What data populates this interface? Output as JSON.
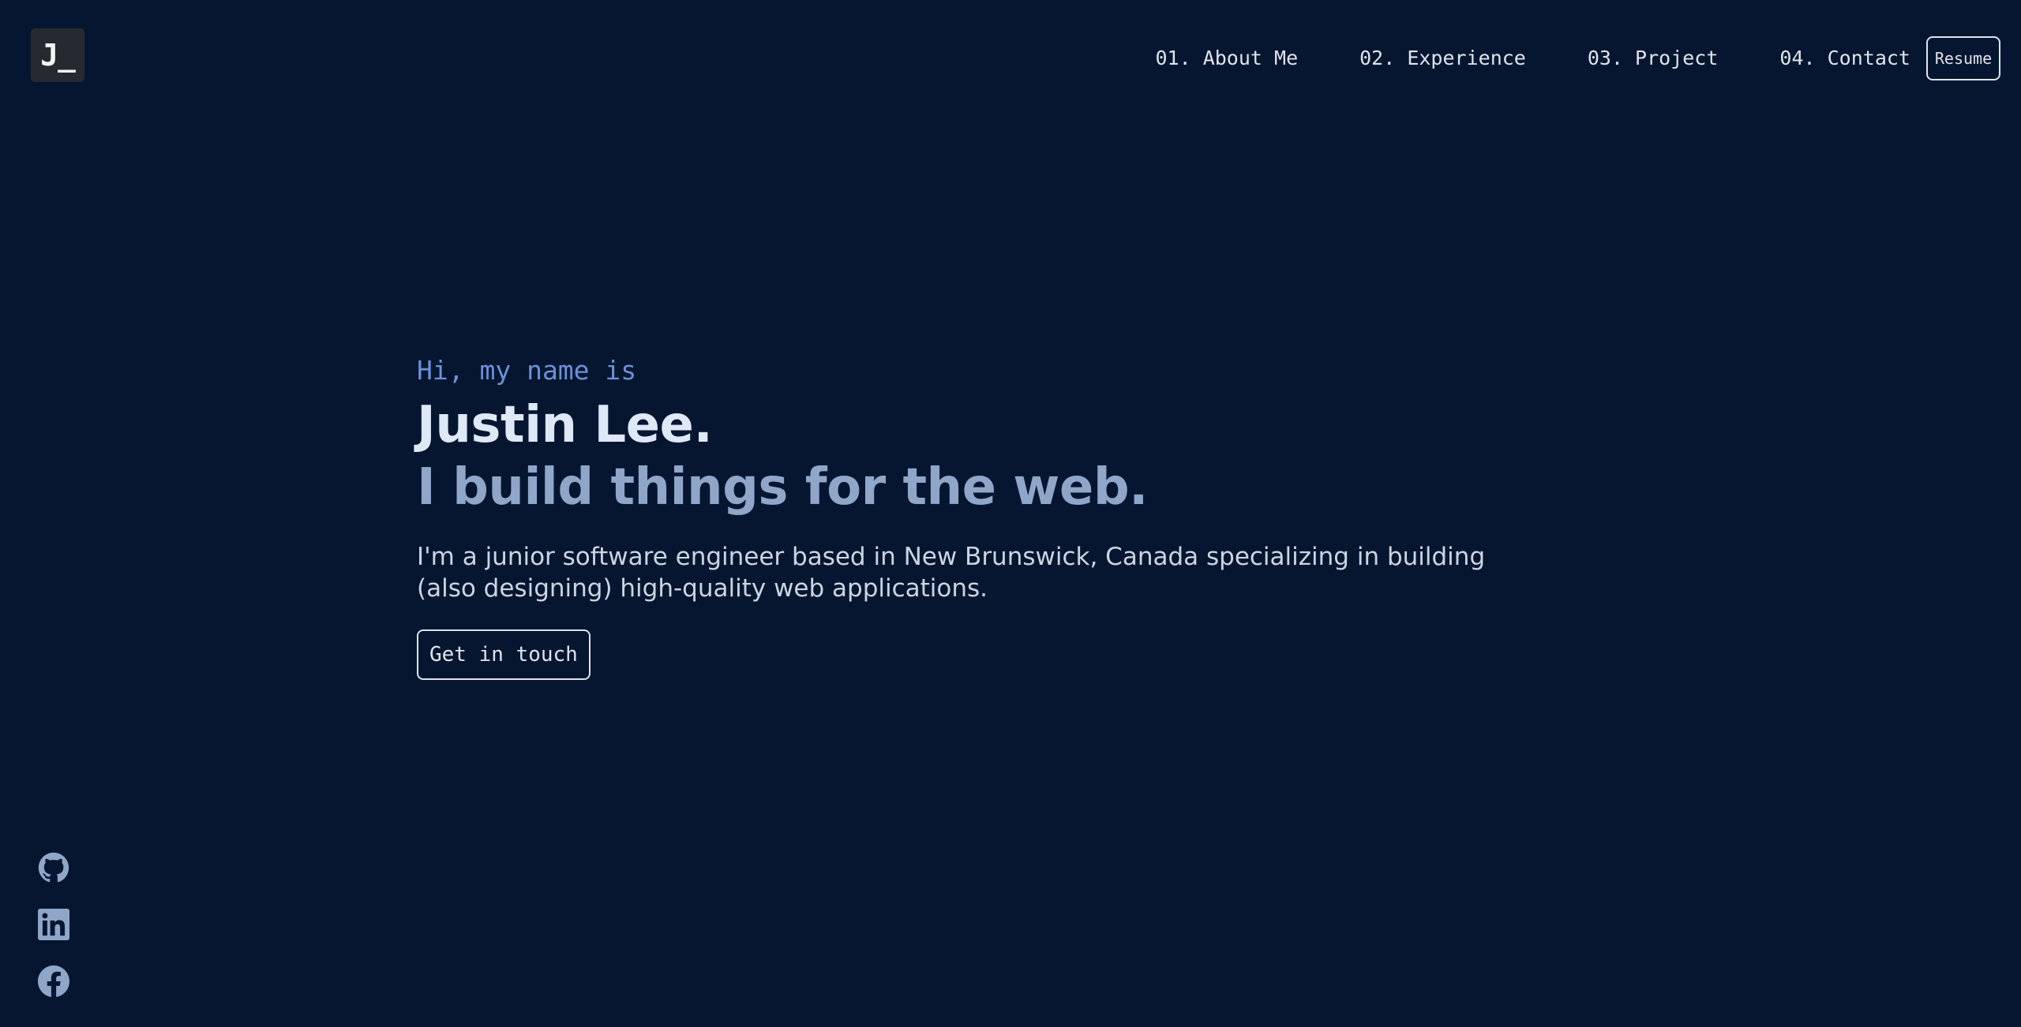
{
  "logo": {
    "text": "J_"
  },
  "nav": {
    "items": [
      {
        "label": "01. About Me"
      },
      {
        "label": "02. Experience"
      },
      {
        "label": "03. Project"
      },
      {
        "label": "04. Contact"
      }
    ],
    "resume_label": "Resume"
  },
  "hero": {
    "greeting": "Hi, my name is",
    "name": "Justin Lee.",
    "tagline": "I build things for the web.",
    "intro": "I'm a junior software engineer based in New Brunswick, Canada specializing in building (also designing) high-quality web applications.",
    "cta_label": "Get in touch"
  },
  "socials": {
    "icons": [
      "github-icon",
      "linkedin-icon",
      "facebook-icon"
    ]
  },
  "colors": {
    "background": "#071630",
    "accent": "#6c91d6",
    "name": "#dfe8f7",
    "tagline": "#8fa6c9",
    "icon": "#8fa6c9"
  }
}
